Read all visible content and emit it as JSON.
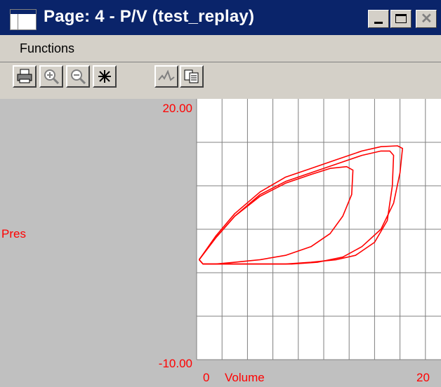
{
  "window": {
    "title": "Page: 4 - P/V (test_replay)",
    "controls": [
      "minimize",
      "maximize",
      "close"
    ]
  },
  "menu": {
    "items": [
      "Functions"
    ]
  },
  "toolbar": {
    "buttons": [
      {
        "icon": "printer-icon"
      },
      {
        "icon": "zoom-in-icon"
      },
      {
        "icon": "zoom-out-icon"
      },
      {
        "icon": "freeze-icon"
      },
      {
        "icon": "waveform-icon"
      },
      {
        "icon": "copy-icon"
      }
    ]
  },
  "colors": {
    "titlebar": "#0a246a",
    "plot_background": "#ffffff",
    "panel_background": "#c0c0c0",
    "trace": "#ff0000",
    "grid": "#808080"
  },
  "chart_data": {
    "type": "line",
    "ylabel": "Pres",
    "xlabel": "Volume",
    "y_tick_labels": [
      "20.00",
      "-10.00"
    ],
    "x_tick_labels": [
      "0",
      "20"
    ],
    "ylim": [
      -10,
      20
    ],
    "xlim": [
      0,
      20
    ],
    "grid": true,
    "series": [
      {
        "x": [
          0.2,
          1.5,
          3.0,
          5.0,
          7.0,
          9.0,
          11.0,
          13.0,
          14.5,
          15.2,
          15.5,
          15.4,
          15.0,
          14.0,
          12.5,
          11.0,
          9.0,
          7.0,
          5.0,
          3.0,
          1.5,
          0.5,
          0.2
        ],
        "y": [
          1.5,
          4.0,
          6.5,
          9.0,
          10.5,
          11.5,
          12.5,
          13.5,
          14.0,
          14.0,
          13.5,
          10.0,
          6.0,
          3.5,
          2.0,
          1.5,
          1.2,
          1.0,
          1.0,
          1.0,
          1.0,
          1.0,
          1.5
        ]
      },
      {
        "x": [
          0.2,
          1.5,
          3.0,
          5.0,
          7.0,
          9.0,
          11.0,
          13.0,
          14.5,
          15.8,
          16.2,
          16.0,
          15.5,
          14.5,
          13.0,
          11.5,
          9.5,
          7.5,
          5.0,
          3.0,
          1.5,
          0.5,
          0.2
        ],
        "y": [
          1.5,
          4.2,
          6.8,
          9.3,
          11.0,
          12.0,
          13.0,
          14.0,
          14.5,
          14.6,
          14.3,
          11.5,
          8.0,
          5.0,
          3.0,
          1.8,
          1.2,
          1.0,
          1.0,
          1.0,
          1.0,
          1.0,
          1.5
        ]
      },
      {
        "x": [
          0.2,
          1.5,
          3.0,
          5.0,
          7.0,
          9.0,
          10.5,
          11.8,
          12.3,
          12.2,
          11.5,
          10.5,
          9.0,
          7.0,
          5.0,
          3.0,
          1.5,
          0.5,
          0.2
        ],
        "y": [
          1.5,
          4.0,
          6.5,
          8.8,
          10.3,
          11.3,
          12.0,
          12.2,
          11.8,
          9.0,
          6.5,
          4.5,
          3.0,
          2.0,
          1.5,
          1.2,
          1.0,
          1.0,
          1.5
        ]
      }
    ]
  }
}
